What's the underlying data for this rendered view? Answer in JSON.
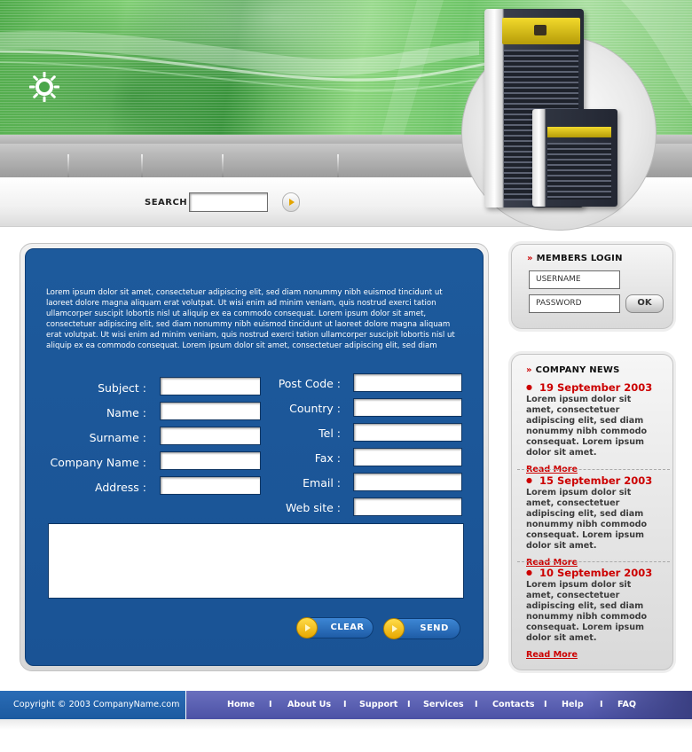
{
  "search": {
    "label": "SEARCH",
    "value": "",
    "placeholder": ""
  },
  "form": {
    "intro": "Lorem ipsum dolor sit amet, consectetuer adipiscing elit, sed diam nonummy nibh euismod tincidunt ut laoreet dolore magna aliquam erat volutpat. Ut wisi enim ad minim veniam, quis nostrud exerci tation ullamcorper suscipit lobortis nisl ut aliquip ex ea commodo consequat. Lorem ipsum dolor sit amet, consectetuer adipiscing elit, sed diam nonummy nibh euismod tincidunt ut laoreet dolore magna aliquam erat volutpat. Ut wisi enim ad minim veniam, quis nostrud exerci tation ullamcorper suscipit lobortis nisl ut aliquip ex ea commodo consequat. Lorem ipsum dolor sit amet, consectetuer adipiscing elit, sed diam",
    "left_fields": [
      {
        "label": "Subject :",
        "value": ""
      },
      {
        "label": "Name :",
        "value": ""
      },
      {
        "label": "Surname :",
        "value": ""
      },
      {
        "label": "Company Name :",
        "value": ""
      },
      {
        "label": "Address :",
        "value": ""
      }
    ],
    "right_fields": [
      {
        "label": "Post Code :",
        "value": ""
      },
      {
        "label": "Country :",
        "value": ""
      },
      {
        "label": "Tel :",
        "value": ""
      },
      {
        "label": "Fax :",
        "value": ""
      },
      {
        "label": "Email :",
        "value": ""
      },
      {
        "label": "Web site :",
        "value": ""
      }
    ],
    "message": "",
    "clear_label": "CLEAR",
    "send_label": "SEND"
  },
  "login": {
    "title": "MEMBERS LOGIN",
    "username_value": "USERNAME",
    "password_value": "PASSWORD",
    "ok_label": "OK"
  },
  "news": {
    "title": "COMPANY NEWS",
    "items": [
      {
        "date": "19 September 2003",
        "text": "Lorem ipsum dolor sit amet, consectetuer adipiscing elit, sed diam nonummy nibh commodo consequat. Lorem ipsum dolor sit amet.",
        "more": "Read More"
      },
      {
        "date": "15 September 2003",
        "text": "Lorem ipsum dolor sit amet, consectetuer adipiscing elit, sed diam nonummy nibh commodo consequat. Lorem ipsum dolor sit amet.",
        "more": "Read More"
      },
      {
        "date": "10 September 2003",
        "text": "Lorem ipsum dolor sit amet, consectetuer adipiscing elit, sed diam nonummy nibh commodo consequat. Lorem ipsum dolor sit amet.",
        "more": "Read More"
      }
    ]
  },
  "footer": {
    "copyright": "Copyright © 2003  CompanyName.com",
    "nav": [
      "Home",
      "About Us",
      "Support",
      "Services",
      "Contacts",
      "Help",
      "FAQ"
    ],
    "separator": "I"
  },
  "colors": {
    "panel_blue": "#1d5a9c",
    "accent_red": "#cc0000",
    "button_yellow": "#ffdc4a",
    "banner_green": "#6cc466"
  }
}
